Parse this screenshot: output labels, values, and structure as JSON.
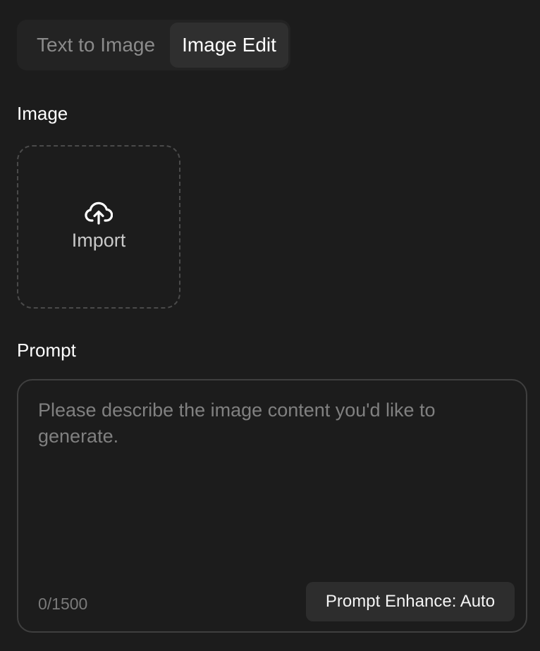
{
  "tabs": [
    {
      "label": "Text to Image",
      "active": false
    },
    {
      "label": "Image Edit",
      "active": true
    }
  ],
  "image_section": {
    "label": "Image",
    "upload": {
      "icon": "cloud-upload-icon",
      "label": "Import"
    }
  },
  "prompt_section": {
    "label": "Prompt",
    "placeholder": "Please describe the image content you'd like to generate.",
    "value": "",
    "counter": "0/1500",
    "enhance_button": "Prompt Enhance: Auto"
  },
  "colors": {
    "background": "#1c1c1c",
    "tab_container": "#232323",
    "tab_active": "#2f2f2f",
    "border": "#3f3f3f",
    "enhance_button": "#2d2d2d"
  }
}
